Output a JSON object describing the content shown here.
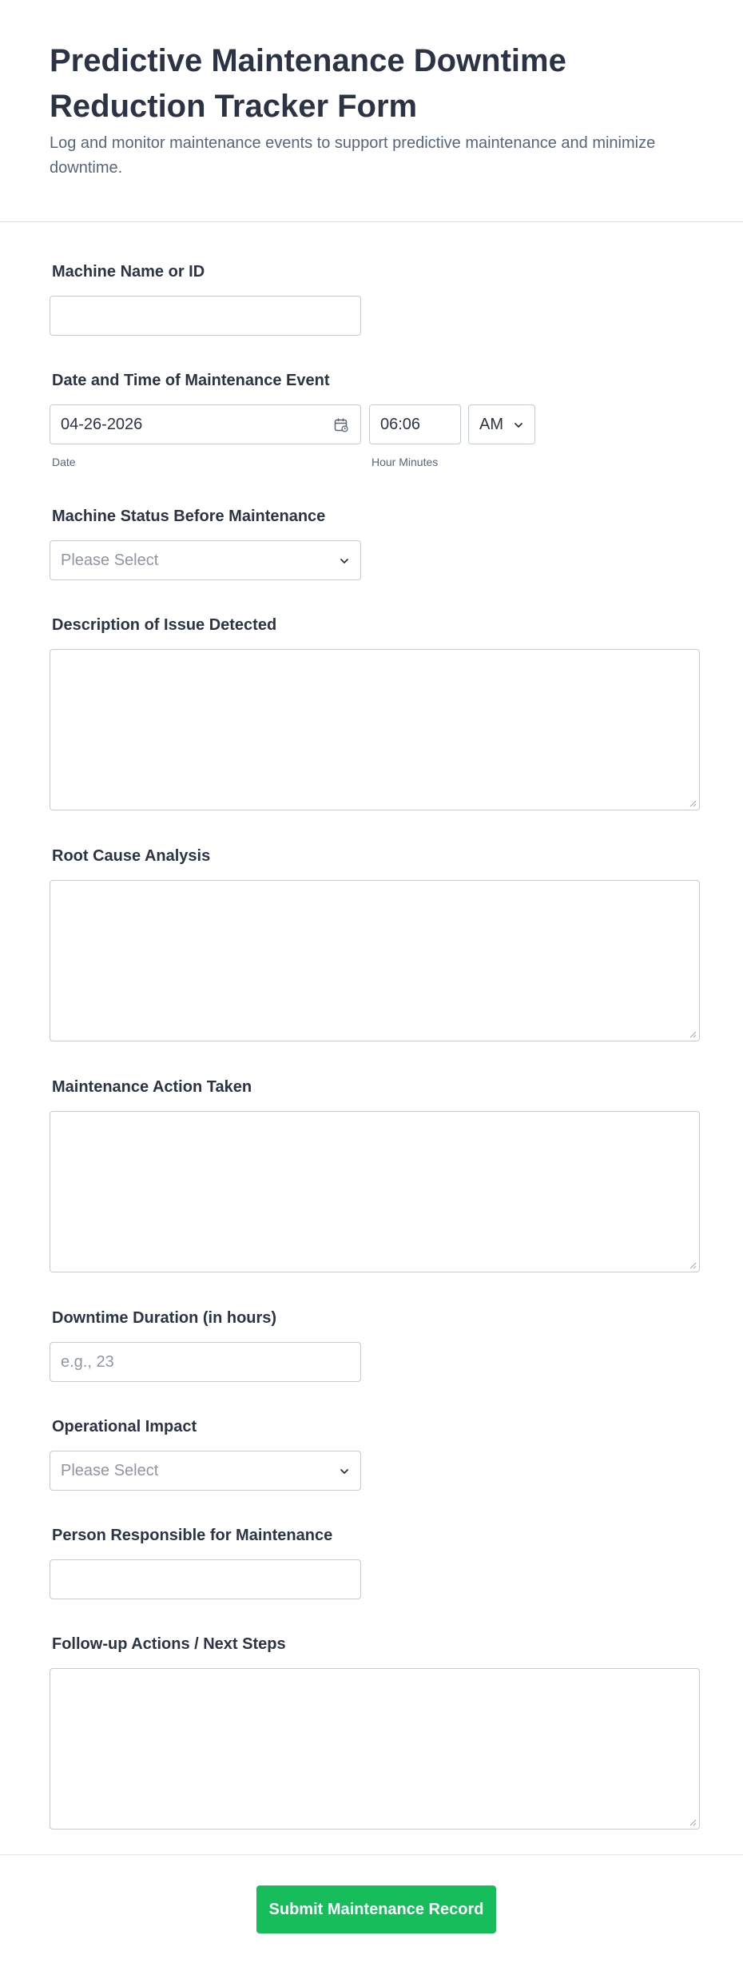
{
  "form": {
    "title": "Predictive Maintenance Downtime Reduction Tracker Form",
    "subtitle": "Log and monitor maintenance events to support predictive maintenance and minimize downtime."
  },
  "fields": {
    "machine": {
      "label": "Machine Name or ID",
      "value": ""
    },
    "datetime": {
      "label": "Date and Time of Maintenance Event",
      "date_value": "04-26-2026",
      "date_sublabel": "Date",
      "time_value": "06:06",
      "time_sublabel": "Hour Minutes",
      "ampm_value": "AM"
    },
    "status_before": {
      "label": "Machine Status Before Maintenance",
      "placeholder": "Please Select"
    },
    "issue_description": {
      "label": "Description of Issue Detected"
    },
    "root_cause": {
      "label": "Root Cause Analysis"
    },
    "action_taken": {
      "label": "Maintenance Action Taken"
    },
    "downtime": {
      "label": "Downtime Duration (in hours)",
      "placeholder": "e.g., 23"
    },
    "impact": {
      "label": "Operational Impact",
      "placeholder": "Please Select"
    },
    "person": {
      "label": "Person Responsible for Maintenance",
      "value": ""
    },
    "follow_up": {
      "label": "Follow-up Actions / Next Steps"
    }
  },
  "submit": {
    "label": "Submit Maintenance Record",
    "color": "#18bd5b"
  },
  "icons": {
    "calendar": "calendar-icon",
    "chevron": "chevron-down-icon",
    "resize": "resize-handle-icon"
  }
}
